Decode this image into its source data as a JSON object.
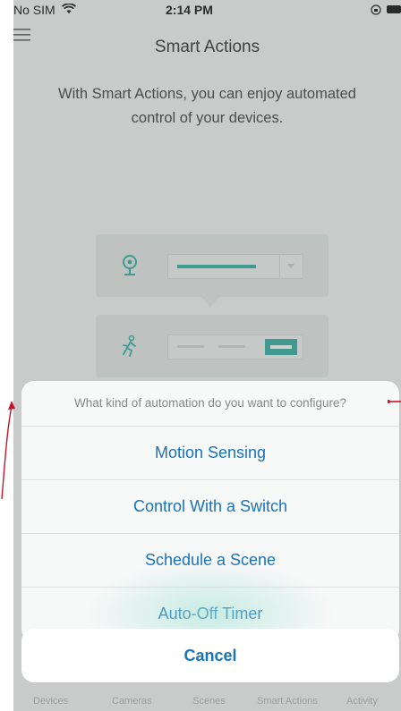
{
  "status_bar": {
    "carrier": "No SIM",
    "time": "2:14 PM"
  },
  "header": {
    "title": "Smart Actions"
  },
  "intro_text": "With Smart Actions, you can enjoy automated control of your devices.",
  "action_sheet": {
    "title": "What kind of automation do you want to configure?",
    "options": [
      "Motion Sensing",
      "Control With a Switch",
      "Schedule a Scene",
      "Auto-Off Timer"
    ],
    "cancel_label": "Cancel"
  },
  "tab_bar": {
    "items": [
      "Devices",
      "Cameras",
      "Scenes",
      "Smart Actions",
      "Activity"
    ]
  },
  "colors": {
    "accent": "#1a73b8",
    "teal": "#23a99a",
    "annotation": "#c0182a"
  },
  "icons": [
    "wifi-icon",
    "battery-icon",
    "menu-icon",
    "camera-icon",
    "motion-sensor-icon"
  ]
}
